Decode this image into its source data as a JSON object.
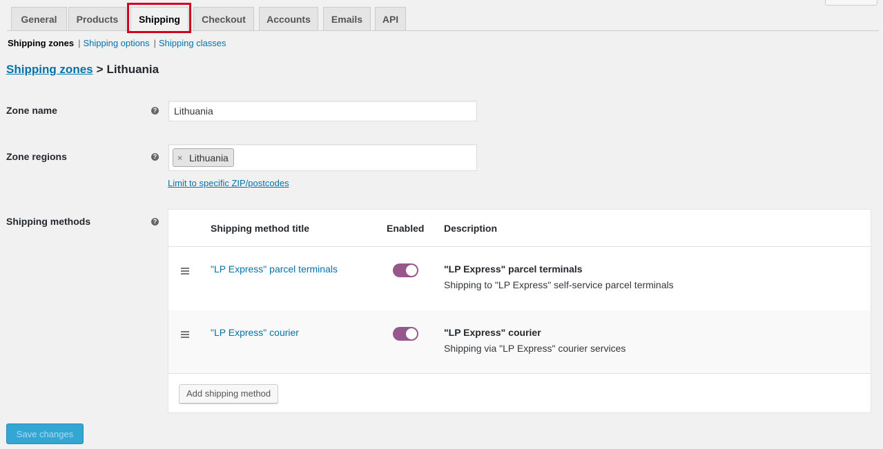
{
  "tabs": [
    {
      "label": "General"
    },
    {
      "label": "Products"
    },
    {
      "label": "Shipping",
      "active": true
    },
    {
      "label": "Checkout"
    },
    {
      "label": "Accounts"
    },
    {
      "label": "Emails"
    },
    {
      "label": "API"
    }
  ],
  "subnav": {
    "current": "Shipping zones",
    "separator": "|",
    "links": [
      "Shipping options",
      "Shipping classes"
    ]
  },
  "breadcrumb": {
    "link": "Shipping zones",
    "separator": ">",
    "current": "Lithuania"
  },
  "form": {
    "zone_name_label": "Zone name",
    "zone_name_value": "Lithuania",
    "zone_regions_label": "Zone regions",
    "region_chip_remove": "×",
    "region_chip": "Lithuania",
    "limit_link": "Limit to specific ZIP/postcodes",
    "shipping_methods_label": "Shipping methods",
    "help_glyph": "?"
  },
  "methods_table": {
    "headers": {
      "title": "Shipping method title",
      "enabled": "Enabled",
      "description": "Description"
    },
    "rows": [
      {
        "title": "\"LP Express\" parcel terminals",
        "enabled": true,
        "desc_title": "\"LP Express\" parcel terminals",
        "desc_text": "Shipping to \"LP Express\" self-service parcel terminals"
      },
      {
        "title": "\"LP Express\" courier",
        "enabled": true,
        "desc_title": "\"LP Express\" courier",
        "desc_text": "Shipping via \"LP Express\" courier services"
      }
    ],
    "add_button": "Add shipping method"
  },
  "save_button": "Save changes",
  "colors": {
    "link": "#0073aa",
    "toggle_on": "#96588a",
    "highlight": "#d0021b",
    "primary_button": "#33a6d3"
  }
}
